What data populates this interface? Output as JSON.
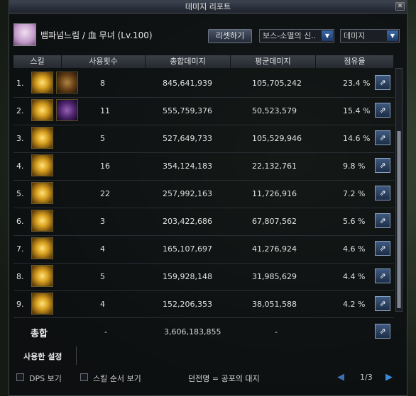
{
  "window": {
    "title": "데미지 리포트",
    "close": "✕"
  },
  "header": {
    "character": "뱀파넘느림 / 血 무녀 (Lv.100)",
    "reset_label": "리셋하기",
    "boss_select": "보스-소멸의 신..",
    "metric_select": "데미지"
  },
  "columns": {
    "skill": "스킬",
    "count": "사용횟수",
    "total": "총합데미지",
    "avg": "평균데미지",
    "share": "점유율"
  },
  "rows": [
    {
      "rank": "1.",
      "count": "8",
      "total": "845,641,939",
      "avg": "105,705,242",
      "share": "23.4 %"
    },
    {
      "rank": "2.",
      "count": "11",
      "total": "555,759,376",
      "avg": "50,523,579",
      "share": "15.4 %"
    },
    {
      "rank": "3.",
      "count": "5",
      "total": "527,649,733",
      "avg": "105,529,946",
      "share": "14.6 %"
    },
    {
      "rank": "4.",
      "count": "16",
      "total": "354,124,183",
      "avg": "22,132,761",
      "share": "9.8 %"
    },
    {
      "rank": "5.",
      "count": "22",
      "total": "257,992,163",
      "avg": "11,726,916",
      "share": "7.2 %"
    },
    {
      "rank": "6.",
      "count": "3",
      "total": "203,422,686",
      "avg": "67,807,562",
      "share": "5.6 %"
    },
    {
      "rank": "7.",
      "count": "4",
      "total": "165,107,697",
      "avg": "41,276,924",
      "share": "4.6 %"
    },
    {
      "rank": "8.",
      "count": "5",
      "total": "159,928,148",
      "avg": "31,985,629",
      "share": "4.4 %"
    },
    {
      "rank": "9.",
      "count": "4",
      "total": "152,206,353",
      "avg": "38,051,588",
      "share": "4.2 %"
    }
  ],
  "total": {
    "label": "총합",
    "count": "-",
    "total": "3,606,183,855",
    "avg": "-"
  },
  "used_settings": "사용한 설정",
  "footer": {
    "dps_label": "DPS 보기",
    "order_label": "스킬 순서 보기",
    "dungeon": "던전명 = 공포의 대지",
    "page": "1/3"
  },
  "icons": {
    "share": "share-icon",
    "prev": "prev-arrow-icon",
    "next": "next-arrow-icon"
  }
}
